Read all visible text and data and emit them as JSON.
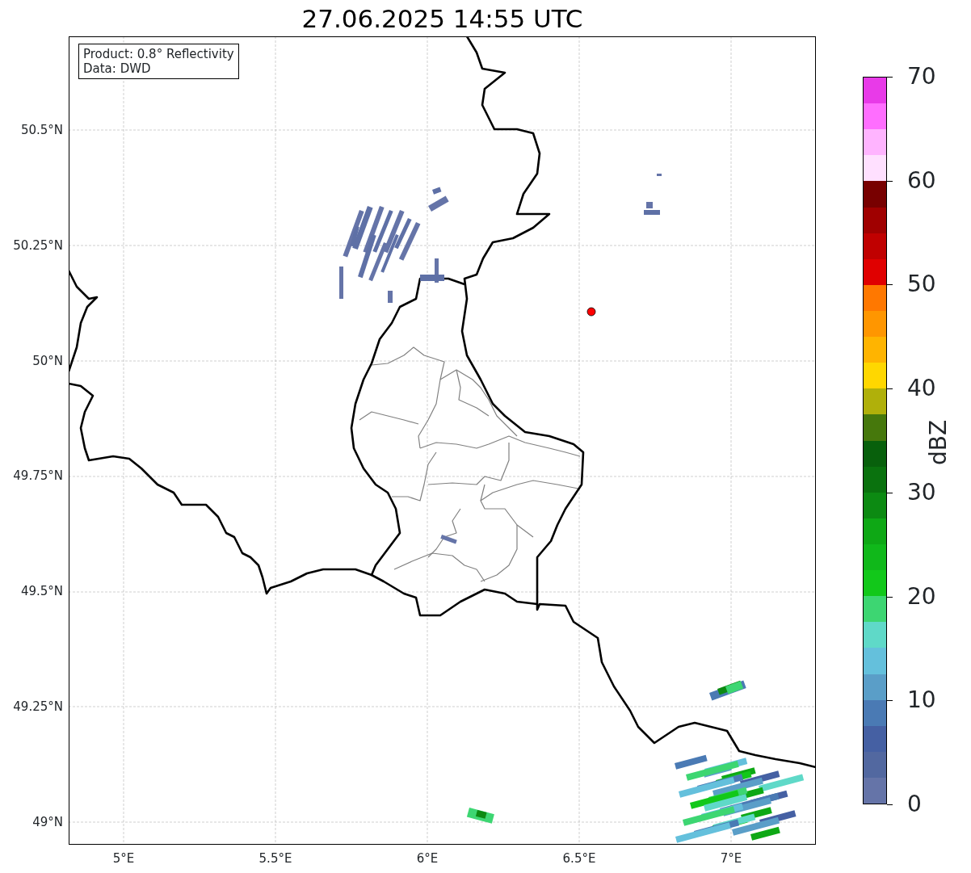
{
  "title": "27.06.2025 14:55 UTC",
  "info_box": [
    "Product: 0.8° Reflectivity",
    "Data: DWD"
  ],
  "x_ticks": [
    "5°E",
    "5.5°E",
    "6°E",
    "6.5°E",
    "7°E"
  ],
  "y_ticks": [
    "50.5°N",
    "50.25°N",
    "50°N",
    "49.75°N",
    "49.5°N",
    "49.25°N",
    "49°N"
  ],
  "colorbar": {
    "label": "dBZ",
    "ticks": [
      "70",
      "60",
      "50",
      "40",
      "30",
      "20",
      "10",
      "0"
    ],
    "bins": [
      {
        "color": "#e83ae8"
      },
      {
        "color": "#ff6eff"
      },
      {
        "color": "#ffb4ff"
      },
      {
        "color": "#ffe0ff"
      },
      {
        "color": "#780000"
      },
      {
        "color": "#a00000"
      },
      {
        "color": "#c00000"
      },
      {
        "color": "#e00000"
      },
      {
        "color": "#ff7800"
      },
      {
        "color": "#ff9600"
      },
      {
        "color": "#ffb400"
      },
      {
        "color": "#ffd700"
      },
      {
        "color": "#b0b00a"
      },
      {
        "color": "#46780c"
      },
      {
        "color": "#08600c"
      },
      {
        "color": "#0a720e"
      },
      {
        "color": "#0c8a12"
      },
      {
        "color": "#0ea815"
      },
      {
        "color": "#10b81a"
      },
      {
        "color": "#12c81a"
      },
      {
        "color": "#3dd672"
      },
      {
        "color": "#5fd9c8"
      },
      {
        "color": "#64c0dc"
      },
      {
        "color": "#5a9ec8"
      },
      {
        "color": "#4a7ab4"
      },
      {
        "color": "#4560a3"
      },
      {
        "color": "#5268a0"
      },
      {
        "color": "#6574a8"
      }
    ]
  }
}
